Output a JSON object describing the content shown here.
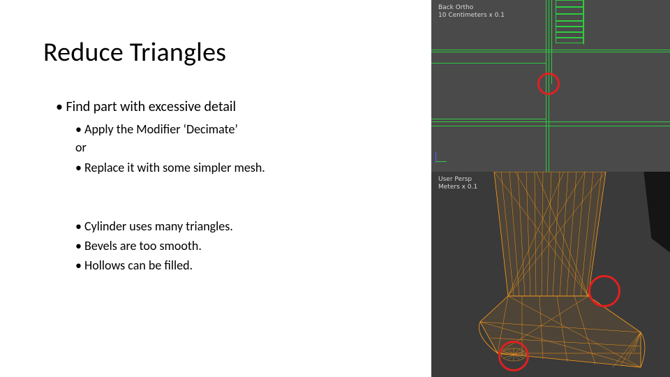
{
  "title": "Reduce Triangles",
  "body": {
    "lvl1_1": "Find part with excessive detail",
    "lvl2_1": "Apply the Modifier ‘Decimate’",
    "or": "or",
    "lvl2_2": "Replace it with some simpler mesh.",
    "lvl2_3": "Cylinder uses many triangles.",
    "lvl2_4": "Bevels are too smooth.",
    "lvl2_5": "Hollows can be filled."
  },
  "wire": {
    "view_line1": "Back Ortho",
    "view_line2": "10 Centimeters x 0.1"
  },
  "persp": {
    "view_line1": "User Persp",
    "view_line2": "Meters x 0.1"
  },
  "colors": {
    "wireframe": "#2ecc40",
    "mesh": "#ff9e1a",
    "annotation": "#e02020",
    "panel_bg_top": "#4a4a4a",
    "panel_bg_bottom": "#3a3a3a"
  }
}
